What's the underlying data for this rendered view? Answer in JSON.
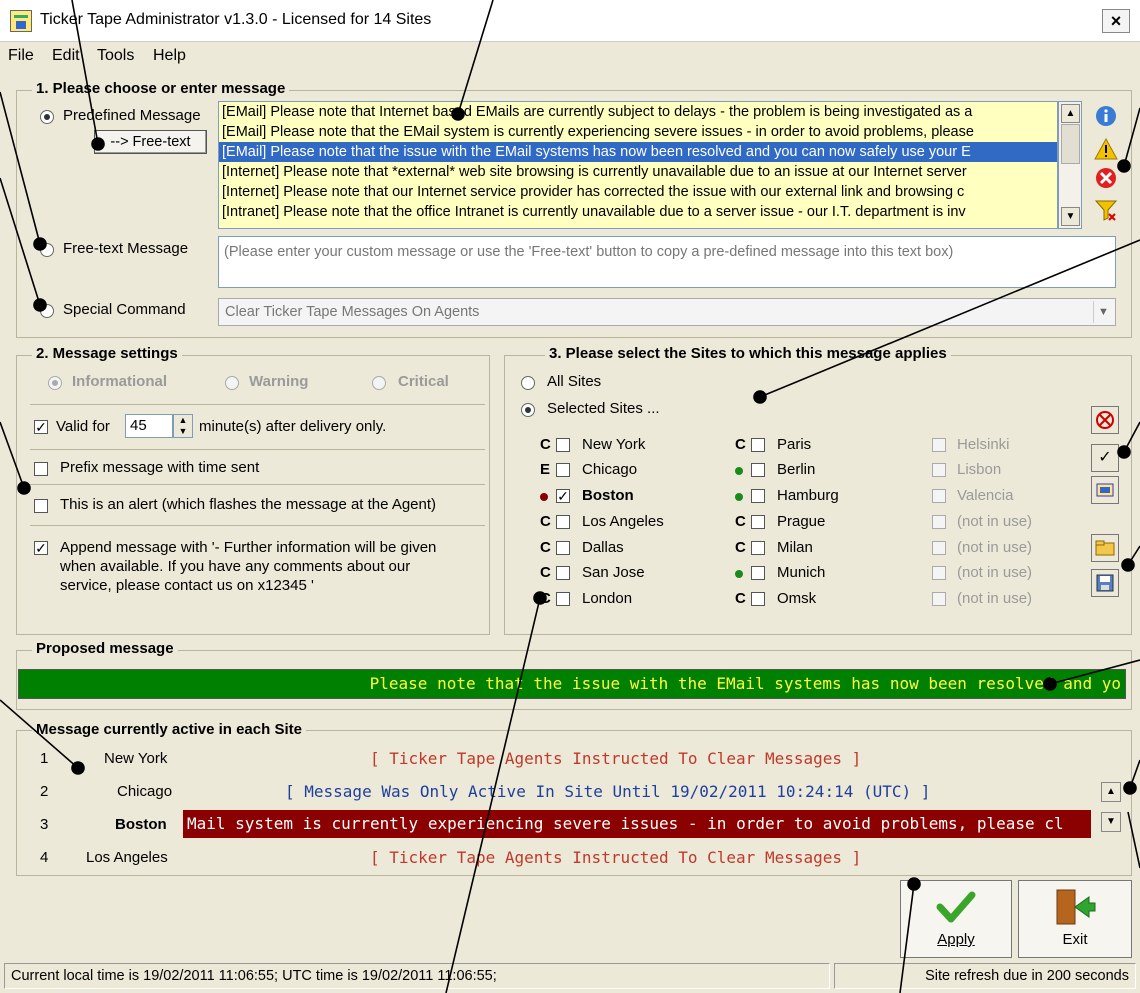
{
  "window": {
    "title": "Ticker Tape Administrator v1.3.0 - Licensed for 14 Sites",
    "close_label": "×"
  },
  "menu": [
    "File",
    "Edit",
    "Tools",
    "Help"
  ],
  "section1": {
    "legend": "1. Please choose or enter message",
    "predefined_label": "Predefined Message",
    "freetext_button": "--> Free-text",
    "freetext_label": "Free-text Message",
    "special_label": "Special Command",
    "messages": [
      "[EMail] Please note that Internet based EMails are currently subject to delays - the problem is being investigated as a",
      "[EMail] Please note that the EMail system is currently experiencing severe issues - in order to avoid problems, please",
      "[EMail] Please note that the issue with the EMail systems has now been resolved and you can now safely use your E",
      "[Internet] Please note that *external* web site browsing is currently unavailable due to an issue at our Internet server",
      "[Internet] Please note that our Internet service provider has corrected the issue with our external link and browsing c",
      "[Intranet] Please note that the office Intranet is currently unavailable due to a server issue - our I.T. department is inv"
    ],
    "selected_message_index": 2,
    "freetext_placeholder": "(Please enter your custom message or use the 'Free-text' button to copy a pre-defined message into this text box)",
    "special_value": "Clear Ticker Tape Messages On Agents"
  },
  "section2": {
    "legend": "2. Message settings",
    "priority": [
      "Informational",
      "Warning",
      "Critical"
    ],
    "valid_for_prefix": "Valid for",
    "valid_for_value": "45",
    "valid_for_suffix": "minute(s) after delivery only.",
    "prefix_time": "Prefix message with time sent",
    "alert": "This is an alert (which flashes the message at the Agent)",
    "append_line1": "Append message with '- Further information will be given",
    "append_line2": "when available. If you have any comments about our",
    "append_line3": "service, please contact us on x12345    '"
  },
  "section3": {
    "legend": "3. Please select the Sites to which this message applies",
    "all_sites": "All Sites",
    "selected_sites": "Selected Sites ...",
    "col1": [
      {
        "code": "C",
        "name": "New York"
      },
      {
        "code": "E",
        "name": "Chicago"
      },
      {
        "code": "",
        "name": "Boston"
      },
      {
        "code": "C",
        "name": "Los Angeles"
      },
      {
        "code": "C",
        "name": "Dallas"
      },
      {
        "code": "C",
        "name": "San Jose"
      },
      {
        "code": "C",
        "name": "London"
      }
    ],
    "col2": [
      {
        "code": "C",
        "name": "Paris"
      },
      {
        "code": "",
        "name": "Berlin"
      },
      {
        "code": "",
        "name": "Hamburg"
      },
      {
        "code": "C",
        "name": "Prague"
      },
      {
        "code": "C",
        "name": "Milan"
      },
      {
        "code": "",
        "name": "Munich"
      },
      {
        "code": "C",
        "name": "Omsk"
      }
    ],
    "col3": [
      "Helsinki",
      "Lisbon",
      "Valencia",
      "(not in use)",
      "(not in use)",
      "(not in use)",
      "(not in use)"
    ]
  },
  "proposed": {
    "legend": "Proposed message",
    "text": "Please note that the issue with the EMail systems has now been resolved and yo"
  },
  "active": {
    "legend": "Message currently active in each Site",
    "rows": [
      {
        "num": "1",
        "site": "New York",
        "msg": "[ Ticker Tape Agents Instructed To Clear Messages ]"
      },
      {
        "num": "2",
        "site": "Chicago",
        "msg": "[ Message Was Only Active In Site Until 19/02/2011 10:24:14 (UTC) ]"
      },
      {
        "num": "3",
        "site": "Boston",
        "msg": "Mail system is currently experiencing severe issues - in order to avoid problems, please cl"
      },
      {
        "num": "4",
        "site": "Los Angeles",
        "msg": "[ Ticker Tape Agents Instructed To Clear Messages ]"
      }
    ]
  },
  "buttons": {
    "apply": "Apply",
    "exit": "Exit"
  },
  "status": {
    "left": "Current local time is 19/02/2011 11:06:55;   UTC time is 19/02/2011 11:06:55;",
    "right": "Site refresh due in 200 seconds"
  },
  "colors": {
    "list_bg": "#ffffc0",
    "selection": "#316ac5",
    "proposed_bg": "#008000",
    "proposed_fg": "#ffff3c",
    "active_bad_bg": "#8b0000",
    "clear_text": "#c0392b",
    "info_text": "#1f3f9f"
  }
}
